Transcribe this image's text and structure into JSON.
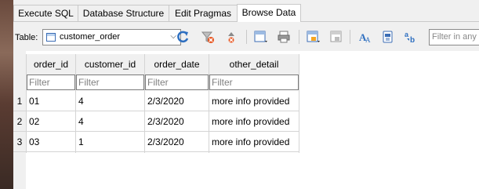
{
  "tabs": [
    {
      "label": "Execute SQL",
      "active": false
    },
    {
      "label": "Database Structure",
      "active": false
    },
    {
      "label": "Edit Pragmas",
      "active": false
    },
    {
      "label": "Browse Data",
      "active": true
    }
  ],
  "toolbar": {
    "table_label": "Table:",
    "selected_table": "customer_order",
    "filter_placeholder": "Filter in any",
    "icons": [
      "refresh-icon",
      "clear-filters-icon",
      "clear-sort-icon",
      "save-table-icon",
      "print-icon",
      "insert-record-icon",
      "delete-record-icon",
      "find-icon",
      "goto-icon",
      "find-replace-icon"
    ]
  },
  "grid": {
    "columns": [
      "order_id",
      "customer_id",
      "order_date",
      "other_detail"
    ],
    "filter_placeholder": "Filter",
    "rows": [
      {
        "num": "1",
        "cells": [
          "01",
          "4",
          "2/3/2020",
          "more info provided"
        ]
      },
      {
        "num": "2",
        "cells": [
          "02",
          "4",
          "2/3/2020",
          "more info provided"
        ]
      },
      {
        "num": "3",
        "cells": [
          "03",
          "1",
          "2/3/2020",
          "more info provided"
        ]
      }
    ]
  },
  "colors": {
    "accent": "#3b6db5",
    "grid_line": "#d4d4d4",
    "header_bg": "#f0f0f0"
  }
}
